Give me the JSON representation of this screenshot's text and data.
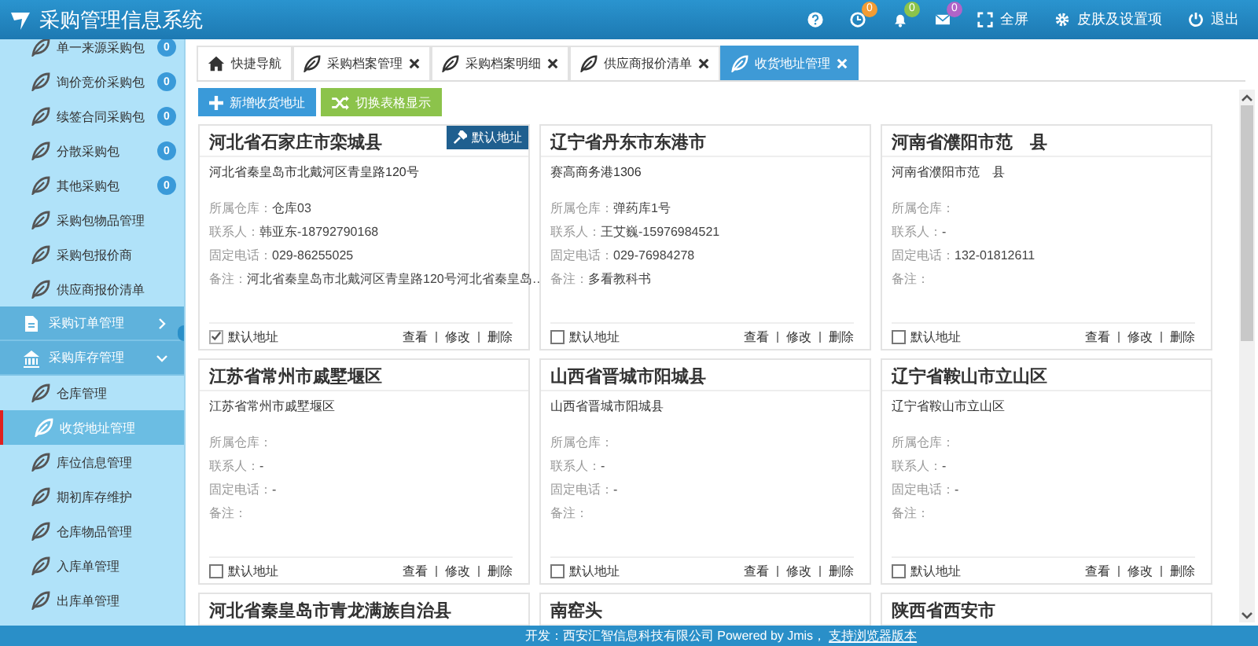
{
  "header": {
    "title": "采购管理信息系统",
    "actions": [
      {
        "kind": "help"
      },
      {
        "kind": "clock",
        "badge": "0",
        "color": "#f39c33"
      },
      {
        "kind": "bell",
        "badge": "0",
        "color": "#8cc34b"
      },
      {
        "kind": "mail",
        "badge": "0",
        "color": "#b064c8"
      },
      {
        "kind": "fullscreen",
        "label": "全屏"
      },
      {
        "kind": "gear",
        "label": "皮肤及设置项"
      },
      {
        "kind": "power",
        "label": "退出"
      }
    ]
  },
  "sidebar": {
    "items": [
      {
        "kind": "leaf",
        "label": "单一来源采购包",
        "badge": "0",
        "selected": false
      },
      {
        "kind": "leaf",
        "label": "询价竞价采购包",
        "badge": "0",
        "selected": false
      },
      {
        "kind": "leaf",
        "label": "续签合同采购包",
        "badge": "0",
        "selected": false
      },
      {
        "kind": "leaf",
        "label": "分散采购包",
        "badge": "0",
        "selected": false
      },
      {
        "kind": "leaf",
        "label": "其他采购包",
        "badge": "0",
        "selected": false
      },
      {
        "kind": "leaf",
        "label": "采购包物品管理",
        "selected": false
      },
      {
        "kind": "leaf",
        "label": "采购包报价商",
        "selected": false
      },
      {
        "kind": "leaf",
        "label": "供应商报价清单",
        "selected": false
      },
      {
        "kind": "group",
        "label": "采购订单管理",
        "expanded": false
      },
      {
        "kind": "group",
        "label": "采购库存管理",
        "expanded": true,
        "children": [
          {
            "kind": "leaf",
            "label": "仓库管理",
            "selected": false
          },
          {
            "kind": "leaf",
            "label": "收货地址管理",
            "selected": true
          },
          {
            "kind": "leaf",
            "label": "库位信息管理",
            "selected": false
          },
          {
            "kind": "leaf",
            "label": "期初库存维护",
            "selected": false
          },
          {
            "kind": "leaf",
            "label": "仓库物品管理",
            "selected": false
          },
          {
            "kind": "leaf",
            "label": "入库单管理",
            "selected": false
          },
          {
            "kind": "leaf",
            "label": "出库单管理",
            "selected": false
          }
        ]
      }
    ]
  },
  "tabs": [
    {
      "kind": "home",
      "label": "快捷导航",
      "closable": false,
      "selected": false
    },
    {
      "kind": "page",
      "label": "采购档案管理",
      "closable": true,
      "selected": false
    },
    {
      "kind": "page",
      "label": "采购档案明细",
      "closable": true,
      "selected": false
    },
    {
      "kind": "page",
      "label": "供应商报价清单",
      "closable": true,
      "selected": false
    },
    {
      "kind": "page",
      "label": "收货地址管理",
      "closable": true,
      "selected": true
    }
  ],
  "toolbar": [
    {
      "kind": "add",
      "label": "新增收货地址"
    },
    {
      "kind": "switch",
      "label": "切换表格显示"
    }
  ],
  "cards": [
    {
      "title": "河北省石家庄市栾城县",
      "badge": "默认地址",
      "address": "河北省秦皇岛市北戴河区青皇路120号",
      "warehouse": {
        "label": "所属仓库：",
        "value": "仓库03"
      },
      "contact": {
        "label": "联系人：",
        "value": "韩亚东-18792790168"
      },
      "phone": {
        "label": "固定电话：",
        "value": "029-86255025"
      },
      "note": {
        "label": "备注：",
        "value": "河北省秦皇岛市北戴河区青皇路120号河北省秦皇岛…"
      },
      "default_label": "默认地址",
      "checked": true,
      "actions": [
        "查看",
        "修改",
        "删除"
      ]
    },
    {
      "title": "辽宁省丹东市东港市",
      "address": "赛高商务港1306",
      "warehouse": {
        "label": "所属仓库：",
        "value": "弹药库1号"
      },
      "contact": {
        "label": "联系人：",
        "value": "王艾巍-15976984521"
      },
      "phone": {
        "label": "固定电话：",
        "value": "029-76984278"
      },
      "note": {
        "label": "备注：",
        "value": "多看教科书"
      },
      "default_label": "默认地址",
      "checked": false,
      "actions": [
        "查看",
        "修改",
        "删除"
      ]
    },
    {
      "title": "河南省濮阳市范　县",
      "address": "河南省濮阳市范　县",
      "warehouse": {
        "label": "所属仓库："
      },
      "contact": {
        "label": "联系人：",
        "value": "-"
      },
      "phone": {
        "label": "固定电话：",
        "value": "132-01812611"
      },
      "note": {
        "label": "备注："
      },
      "default_label": "默认地址",
      "checked": false,
      "actions": [
        "查看",
        "修改",
        "删除"
      ]
    },
    {
      "title": "江苏省常州市戚墅堰区",
      "address": "江苏省常州市戚墅堰区",
      "warehouse": {
        "label": "所属仓库："
      },
      "contact": {
        "label": "联系人：",
        "value": "-"
      },
      "phone": {
        "label": "固定电话：",
        "value": "-"
      },
      "note": {
        "label": "备注："
      },
      "default_label": "默认地址",
      "checked": false,
      "actions": [
        "查看",
        "修改",
        "删除"
      ]
    },
    {
      "title": "山西省晋城市阳城县",
      "address": "山西省晋城市阳城县",
      "warehouse": {
        "label": "所属仓库："
      },
      "contact": {
        "label": "联系人：",
        "value": "-"
      },
      "phone": {
        "label": "固定电话：",
        "value": "-"
      },
      "note": {
        "label": "备注："
      },
      "default_label": "默认地址",
      "checked": false,
      "actions": [
        "查看",
        "修改",
        "删除"
      ]
    },
    {
      "title": "辽宁省鞍山市立山区",
      "address": "辽宁省鞍山市立山区",
      "warehouse": {
        "label": "所属仓库："
      },
      "contact": {
        "label": "联系人：",
        "value": "-"
      },
      "phone": {
        "label": "固定电话：",
        "value": "-"
      },
      "note": {
        "label": "备注："
      },
      "default_label": "默认地址",
      "checked": false,
      "actions": [
        "查看",
        "修改",
        "删除"
      ]
    },
    {
      "title": "河北省秦皇岛市青龙满族自治县"
    },
    {
      "title": "南窑头"
    },
    {
      "title": "陕西省西安市"
    }
  ],
  "footer": {
    "text": "开发：西安汇智信息科技有限公司 Powered by Jmis，",
    "link": "支持浏览器版本"
  }
}
